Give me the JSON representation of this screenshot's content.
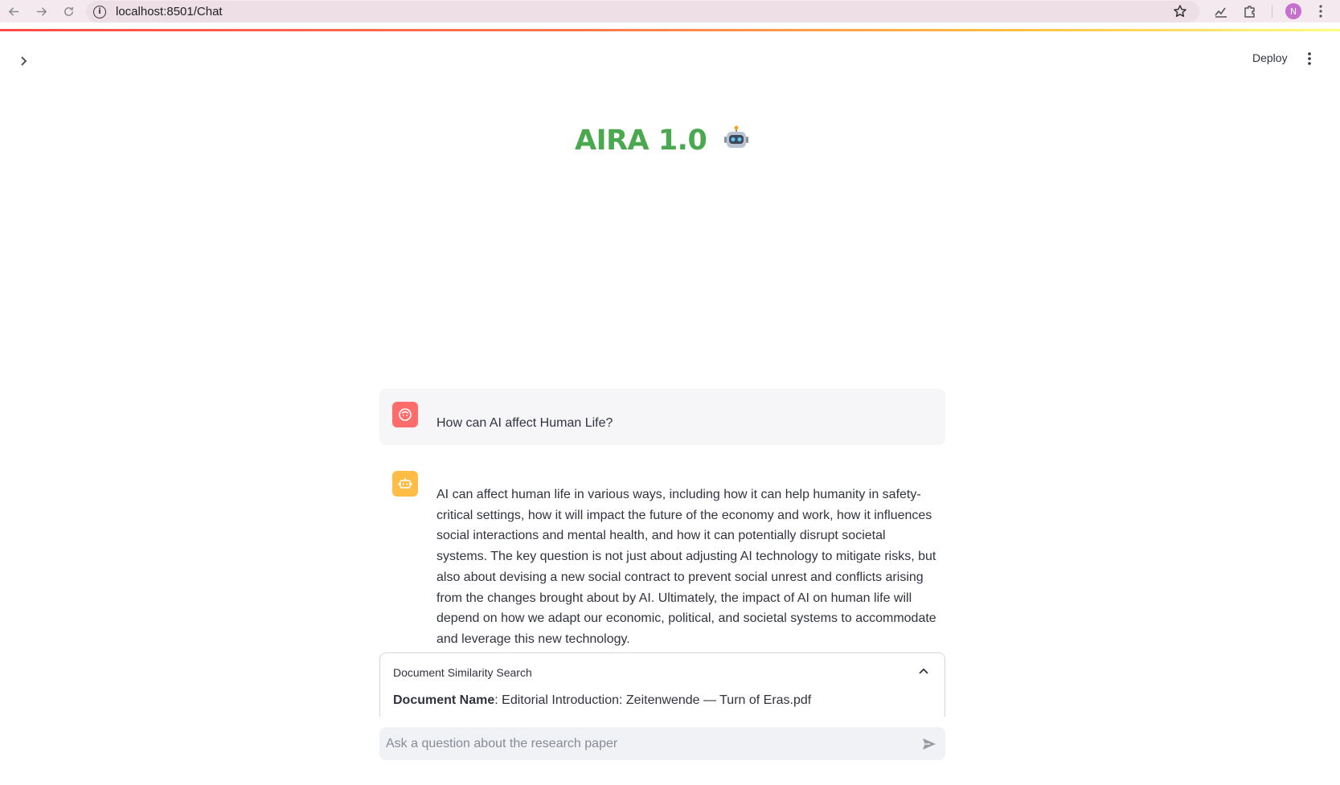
{
  "browser": {
    "url": "localhost:8501/Chat",
    "profile_initial": "N",
    "icons": [
      "back-icon",
      "forward-icon",
      "reload-icon",
      "site-info-icon",
      "bookmark-star-icon",
      "performance-icon",
      "extensions-icon",
      "kebab-icon"
    ]
  },
  "app": {
    "deploy_label": "Deploy",
    "title": "AIRA 1.0",
    "title_emoji": "robot",
    "title_color": "#4aa84f"
  },
  "chat": {
    "messages": [
      {
        "role": "user",
        "avatar_color": "#ff6c6c",
        "text": "How can AI affect Human Life?"
      },
      {
        "role": "assistant",
        "avatar_color": "#ffbd45",
        "text": "AI can affect human life in various ways, including how it can help humanity in safety-critical settings, how it will impact the future of the economy and work, how it influences social interactions and mental health, and how it can potentially disrupt societal systems. The key question is not just about adjusting AI technology to mitigate risks, but also about devising a new social contract to prevent social unrest and conflicts arising from the changes brought about by AI. Ultimately, the impact of AI on human life will depend on how we adapt our economic, political, and societal systems to accommodate and leverage this new technology."
      }
    ],
    "expander": {
      "label": "Document Similarity Search",
      "doc_label": "Document Name",
      "doc_name": "Editorial Introduction: Zeitenwende — Turn of Eras.pdf"
    },
    "input": {
      "placeholder": "Ask a question about the research paper",
      "value": ""
    }
  }
}
